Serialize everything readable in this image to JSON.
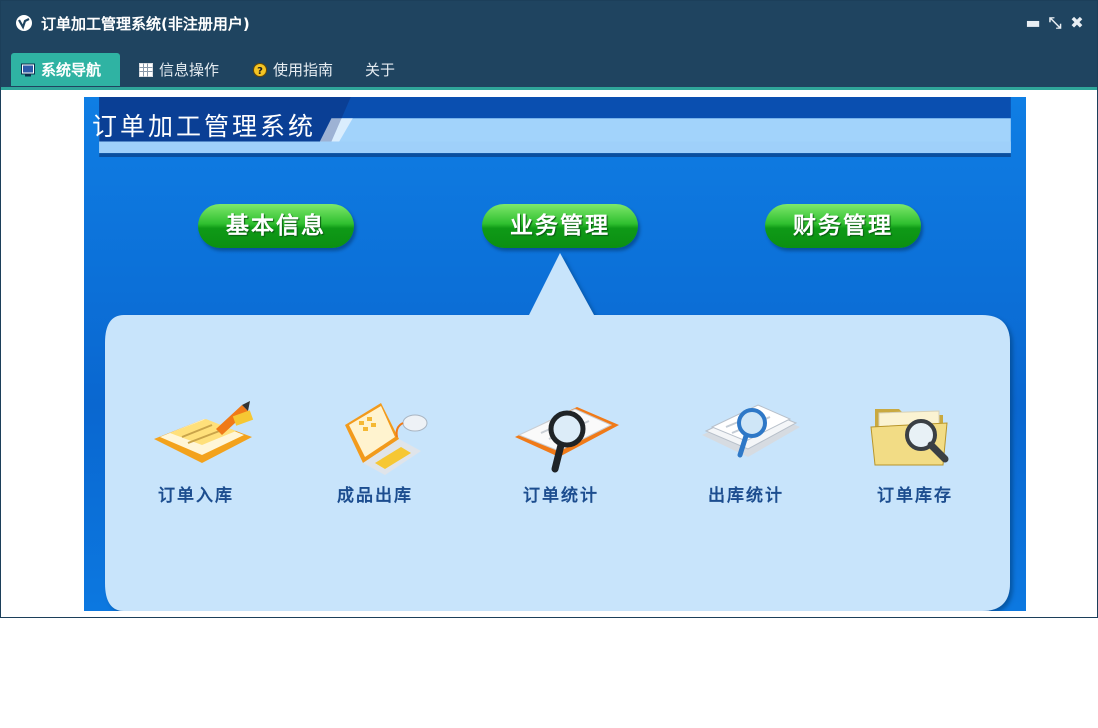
{
  "window": {
    "title": "订单加工管理系统(非注册用户)",
    "minimize_glyph": "▬",
    "restore_glyph": "⤡",
    "close_glyph": "✖"
  },
  "tabs": [
    {
      "label": "系统导航",
      "icon": "monitor-icon",
      "active": true
    },
    {
      "label": "信息操作",
      "icon": "grid-icon",
      "active": false
    },
    {
      "label": "使用指南",
      "icon": "help-icon",
      "active": false
    },
    {
      "label": "关于",
      "icon": "",
      "active": false
    }
  ],
  "banner": {
    "title": "订单加工管理系统"
  },
  "categories": [
    {
      "label": "基本信息"
    },
    {
      "label": "业务管理"
    },
    {
      "label": "财务管理"
    }
  ],
  "modules": [
    {
      "label": "订单入库",
      "icon": "order-entry-icon"
    },
    {
      "label": "成品出库",
      "icon": "laptop-icon"
    },
    {
      "label": "订单统计",
      "icon": "magnifier-document-icon"
    },
    {
      "label": "出库统计",
      "icon": "magnifier-papers-icon"
    },
    {
      "label": "订单库存",
      "icon": "folder-search-icon"
    }
  ],
  "colors": {
    "titlebar": "#1f4460",
    "active_tab": "#2fb3a3",
    "content_blue": "#0a67d0",
    "panel": "#c8e4fb",
    "pill_green": "#1fae22",
    "module_text": "#1c4d8f"
  }
}
